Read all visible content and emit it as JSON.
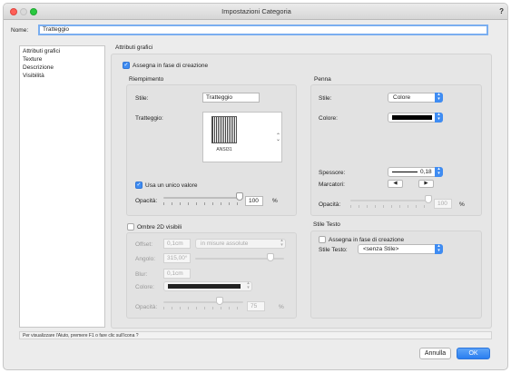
{
  "window": {
    "title": "Impostazioni Categoria",
    "help": "?"
  },
  "name_field": {
    "label": "Nome:",
    "value": "Tratteggio"
  },
  "sidebar": {
    "items": [
      {
        "label": "Attributi grafici",
        "selected": true
      },
      {
        "label": "Texture",
        "selected": false
      },
      {
        "label": "Descrizione",
        "selected": false
      },
      {
        "label": "Visibilità",
        "selected": false
      }
    ]
  },
  "panel": {
    "title": "Attributi grafici",
    "assign_on_create": {
      "label": "Assegna in fase di creazione",
      "checked": true
    }
  },
  "riempimento": {
    "title": "Riempimento",
    "stile_label": "Stile:",
    "stile_value": "Tratteggio",
    "tratteggio_label": "Tratteggio:",
    "hatch_name": "ANSI31",
    "unico_valore": {
      "label": "Usa un unico valore",
      "checked": true
    },
    "opacita_label": "Opacità:",
    "opacita_value": "100",
    "opacita_unit": "%",
    "opacita_level": 1.0
  },
  "penna": {
    "title": "Penna",
    "stile_label": "Stile:",
    "stile_value": "Colore",
    "colore_label": "Colore:",
    "colore_swatch": "#000000",
    "spessore_label": "Spessore:",
    "spessore_value": "0,18",
    "marcatori_label": "Marcatori:",
    "marker_left": "◀",
    "marker_right": "▶",
    "opacita_label": "Opacità:",
    "opacita_value": "100",
    "opacita_unit": "%",
    "opacita_level": 1.0
  },
  "ombre": {
    "toggle": {
      "label": "Ombre 2D visibili",
      "checked": false
    },
    "offset_label": "Offset:",
    "offset_value": "0,1cm",
    "offset_mode": "in misure assolute",
    "angolo_label": "Angolo:",
    "angolo_value": "315,00°",
    "angolo_level": 0.875,
    "blur_label": "Blur:",
    "blur_value": "0,1cm",
    "colore_label": "Colore:",
    "colore_swatch": "#222222",
    "opacita_label": "Opacità:",
    "opacita_value": "75",
    "opacita_unit": "%",
    "opacita_level": 0.75
  },
  "stile_testo": {
    "title": "Stile Testo",
    "assign": {
      "label": "Assegna in fase di creazione",
      "checked": false
    },
    "label": "Stile Testo:",
    "value": "<senza Stile>"
  },
  "status_bar": {
    "text": "Per visualizzare l'Aiuto, premere F1 o fare clic sull'icona ?"
  },
  "buttons": {
    "cancel": "Annulla",
    "ok": "OK"
  },
  "colors": {
    "accent": "#3f8cf2",
    "close": "#fe5f57",
    "minimize": "#d9d9d9",
    "zoom": "#29c940"
  }
}
